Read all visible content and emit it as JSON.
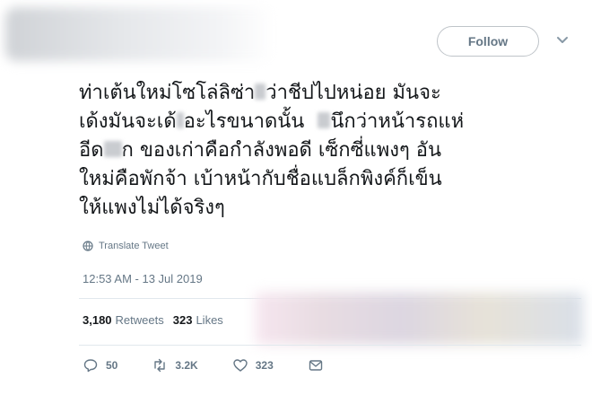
{
  "header": {
    "follow_label": "Follow"
  },
  "tweet": {
    "lines": [
      "ท่าเต้นใหม่โซโล่ลิซ่า",
      "ว่าชีปไปหน่อย มันจะ",
      "เด้งมันจะเด้",
      "อะไรขนาดนั้น",
      "นึกว่าหน้ารถแห่",
      "อีด",
      "ก ของเก่าคือกำลังพอดี เซ็กซี่แพงๆ อัน",
      "ใหม่คือพักจ้า เบ้าหน้ากับชื่อแบล็กพิงค์ก็เข็น",
      "ให้แพงไม่ได้จริงๆ"
    ],
    "translate_label": "Translate Tweet",
    "timestamp": "12:53 AM - 13 Jul 2019"
  },
  "stats": {
    "retweets_count": "3,180",
    "retweets_label": "Retweets",
    "likes_count": "323",
    "likes_label": "Likes"
  },
  "actions": {
    "reply_count": "50",
    "retweet_count": "3.2K",
    "like_count": "323"
  },
  "colors": {
    "text": "#14171a",
    "muted": "#657786",
    "border": "#e1e8ed"
  }
}
